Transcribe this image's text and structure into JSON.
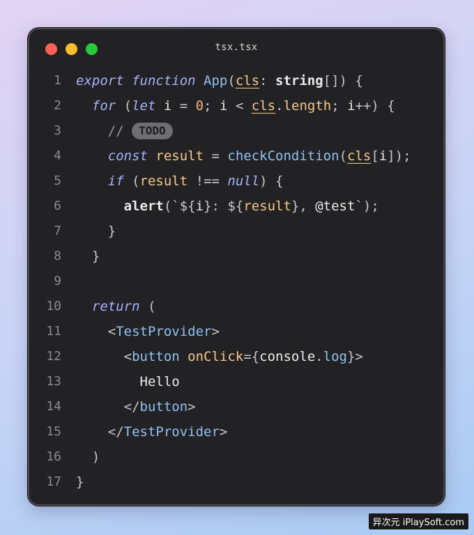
{
  "window": {
    "title": "tsx.tsx",
    "traffic_lights": [
      "close-dot",
      "minimize-dot",
      "zoom-dot"
    ]
  },
  "code": {
    "line_numbers": [
      "1",
      "2",
      "3",
      "4",
      "5",
      "6",
      "7",
      "8",
      "9",
      "10",
      "11",
      "12",
      "13",
      "14",
      "15",
      "16",
      "17"
    ],
    "lines": [
      [
        [
          "kw",
          "export function "
        ],
        [
          "fn",
          "App"
        ],
        [
          "pun",
          "("
        ],
        [
          "prm",
          "cls"
        ],
        [
          "pun",
          ": "
        ],
        [
          "typ",
          "string"
        ],
        [
          "pun",
          "[]) {"
        ]
      ],
      [
        [
          "t",
          "  "
        ],
        [
          "kw",
          "for "
        ],
        [
          "pun",
          "("
        ],
        [
          "kw",
          "let "
        ],
        [
          "str",
          "i "
        ],
        [
          "pun",
          "= "
        ],
        [
          "num",
          "0"
        ],
        [
          "pun",
          "; "
        ],
        [
          "str",
          "i "
        ],
        [
          "pun",
          "< "
        ],
        [
          "prm",
          "cls"
        ],
        [
          "pun",
          "."
        ],
        [
          "var",
          "length"
        ],
        [
          "pun",
          "; "
        ],
        [
          "str",
          "i"
        ],
        [
          "pun",
          "++) {"
        ]
      ],
      [
        [
          "t",
          "    "
        ],
        [
          "cm",
          "// "
        ],
        [
          "badge",
          "TODO"
        ]
      ],
      [
        [
          "t",
          "    "
        ],
        [
          "kw",
          "const "
        ],
        [
          "var",
          "result "
        ],
        [
          "pun",
          "= "
        ],
        [
          "fn",
          "checkCondition"
        ],
        [
          "pun",
          "("
        ],
        [
          "prm",
          "cls"
        ],
        [
          "pun",
          "["
        ],
        [
          "str",
          "i"
        ],
        [
          "pun",
          "]);"
        ]
      ],
      [
        [
          "t",
          "    "
        ],
        [
          "kw",
          "if "
        ],
        [
          "pun",
          "("
        ],
        [
          "var",
          "result "
        ],
        [
          "pun",
          "!== "
        ],
        [
          "kw",
          "null"
        ],
        [
          "pun",
          ") {"
        ]
      ],
      [
        [
          "t",
          "      "
        ],
        [
          "bi",
          "alert"
        ],
        [
          "pun",
          "(`${"
        ],
        [
          "str",
          "i"
        ],
        [
          "pun",
          "}: ${"
        ],
        [
          "var",
          "result"
        ],
        [
          "pun",
          "}, "
        ],
        [
          "str",
          "@test"
        ],
        [
          "pun",
          "`);"
        ]
      ],
      [
        [
          "t",
          "    "
        ],
        [
          "pun",
          "}"
        ]
      ],
      [
        [
          "t",
          "  "
        ],
        [
          "pun",
          "}"
        ]
      ],
      [],
      [
        [
          "t",
          "  "
        ],
        [
          "kw",
          "return "
        ],
        [
          "pun",
          "("
        ]
      ],
      [
        [
          "t",
          "    "
        ],
        [
          "pun",
          "<"
        ],
        [
          "tag",
          "TestProvider"
        ],
        [
          "pun",
          ">"
        ]
      ],
      [
        [
          "t",
          "      "
        ],
        [
          "pun",
          "<"
        ],
        [
          "tag",
          "button "
        ],
        [
          "attr",
          "onClick"
        ],
        [
          "pun",
          "={"
        ],
        [
          "str",
          "console"
        ],
        [
          "pun",
          "."
        ],
        [
          "fn",
          "log"
        ],
        [
          "pun",
          "}>"
        ]
      ],
      [
        [
          "t",
          "        "
        ],
        [
          "str",
          "Hello"
        ]
      ],
      [
        [
          "t",
          "      "
        ],
        [
          "pun",
          "</"
        ],
        [
          "tag",
          "button"
        ],
        [
          "pun",
          ">"
        ]
      ],
      [
        [
          "t",
          "    "
        ],
        [
          "pun",
          "</"
        ],
        [
          "tag",
          "TestProvider"
        ],
        [
          "pun",
          ">"
        ]
      ],
      [
        [
          "t",
          "  "
        ],
        [
          "pun",
          ")"
        ]
      ],
      [
        [
          "pun",
          "}"
        ]
      ]
    ]
  },
  "watermark": "异次元 iPlaySoft.com"
}
